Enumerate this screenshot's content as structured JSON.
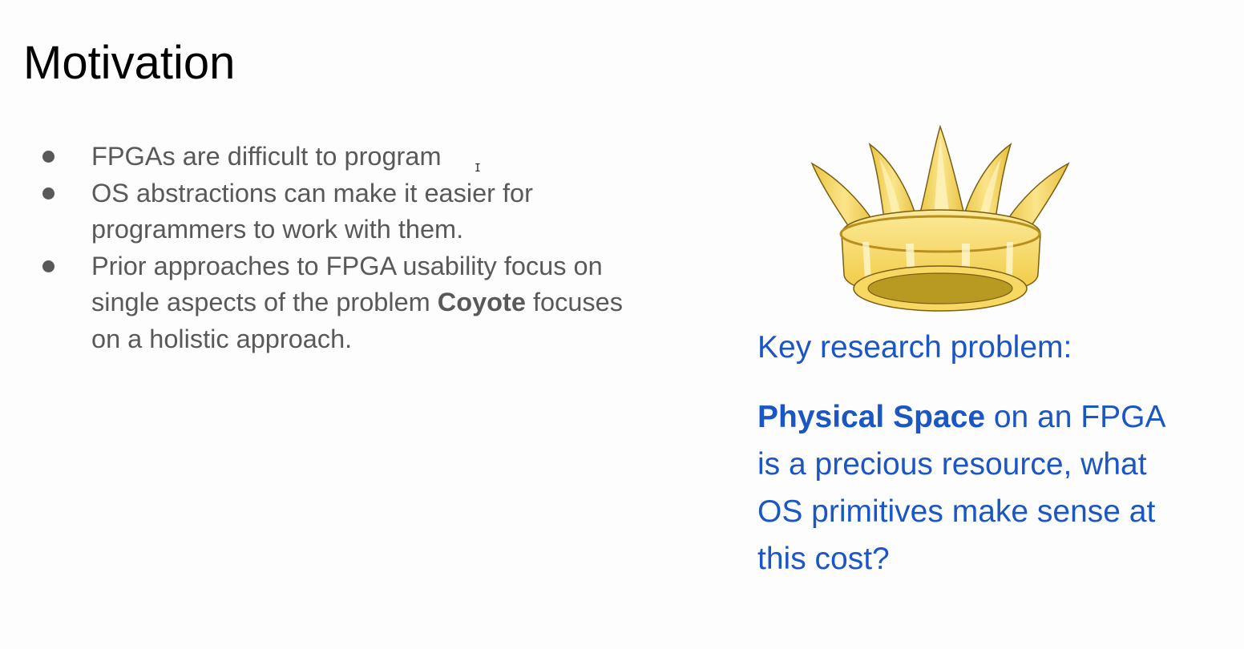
{
  "slide": {
    "title": "Motivation",
    "bullets": [
      {
        "text": "FPGAs are difficult to program"
      },
      {
        "text": "OS abstractions can make it easier for programmers to work with them."
      },
      {
        "prefix": "Prior approaches to FPGA usability focus on single aspects of the problem ",
        "bold": "Coyote",
        "suffix": " focuses on a holistic approach."
      }
    ],
    "image": {
      "icon": "crown-icon"
    },
    "key_heading": "Key research problem:",
    "key_bold": "Physical Space",
    "key_rest": " on an FPGA is a precious resource, what OS primitives make sense at this cost?"
  },
  "colors": {
    "title": "#000000",
    "body": "#595959",
    "accent": "#1a56c4",
    "background": "#fdfdfd"
  },
  "cursor": {
    "glyph": "I"
  }
}
